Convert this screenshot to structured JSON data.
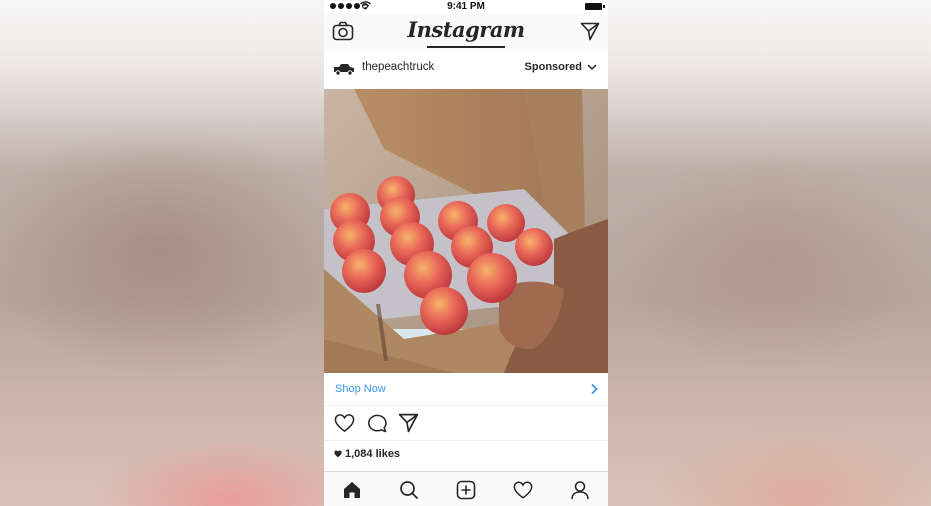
{
  "status_bar": {
    "time": "9:41 PM"
  },
  "nav": {
    "logo": "Instagram"
  },
  "post": {
    "username": "thepeachtruck",
    "sponsored_label": "Sponsored",
    "cta_label": "Shop Now",
    "likes": "1,084 likes"
  },
  "icons": {
    "nav": [
      "camera-icon",
      "direct-message-icon"
    ],
    "header": [
      "truck-avatar-icon",
      "chevron-down-icon"
    ],
    "actions": [
      "heart-icon",
      "comment-icon",
      "share-icon"
    ],
    "tabs": [
      "home-icon",
      "search-icon",
      "add-post-icon",
      "activity-heart-icon",
      "profile-icon"
    ]
  },
  "colors": {
    "link_blue": "#3897f0",
    "text": "#262626"
  }
}
